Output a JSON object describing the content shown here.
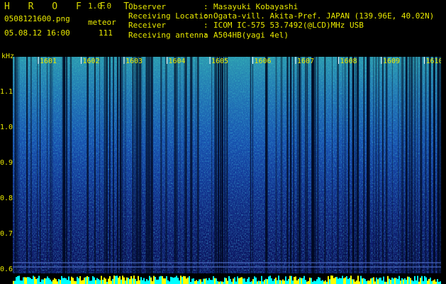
{
  "header": {
    "brand": "H R O F F T",
    "version": "1.0.0",
    "filename": "0508121600.png",
    "datetime": "05.08.12 16:00",
    "event_label": "meteor",
    "event_count": "111"
  },
  "meta": [
    {
      "key": "Observer",
      "value": "Masayuki Kobayashi"
    },
    {
      "key": "Receiving Location",
      "value": "Ogata-vill. Akita-Pref. JAPAN (139.96E, 40.02N)"
    },
    {
      "key": "Receiver",
      "value": "ICOM IC-575 53.7492(@LCD)MHz USB"
    },
    {
      "key": "Receiving antenna",
      "value": "A504HB(yagi 4el)"
    }
  ],
  "spectrogram": {
    "y_unit": "kHz",
    "y_ticks": [
      "1.1",
      "1.0",
      "0.9",
      "0.8",
      "0.7",
      "0.6"
    ],
    "time_labels": [
      "1601",
      "1602",
      "1603",
      "1604",
      "1605",
      "1606",
      "1607",
      "1608",
      "1609",
      "1610"
    ],
    "colors": {
      "text": "#e8e800",
      "signal": "#00ffff",
      "baseline": "#ffff00"
    }
  }
}
